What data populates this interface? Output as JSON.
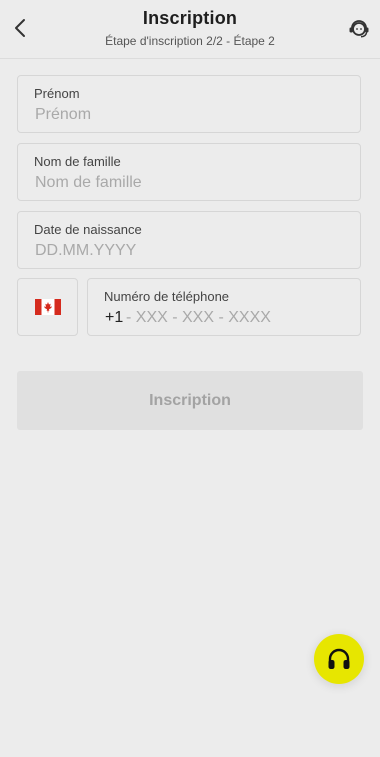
{
  "header": {
    "title": "Inscription",
    "subtitle": "Étape d'inscription 2/2 - Étape 2",
    "back_icon": "chevron-left-icon",
    "support_icon": "support-agent-icon"
  },
  "form": {
    "first_name": {
      "label": "Prénom",
      "placeholder": "Prénom"
    },
    "last_name": {
      "label": "Nom de famille",
      "placeholder": "Nom de famille"
    },
    "birth_date": {
      "label": "Date de naissance",
      "placeholder": "DD.MM.YYYY"
    },
    "country_flag": "canada-flag-icon",
    "phone": {
      "label": "Numéro de téléphone",
      "country_code": "+1",
      "placeholder": "- XXX - XXX - XXXX"
    }
  },
  "submit": {
    "label": "Inscription"
  },
  "fab": {
    "icon": "headphones-icon"
  },
  "colors": {
    "background": "#ececec",
    "accent": "#e7e600",
    "flag_red": "#d52b1e",
    "button_disabled_bg": "#e0e0e0",
    "button_disabled_text": "#a3a3a3"
  }
}
